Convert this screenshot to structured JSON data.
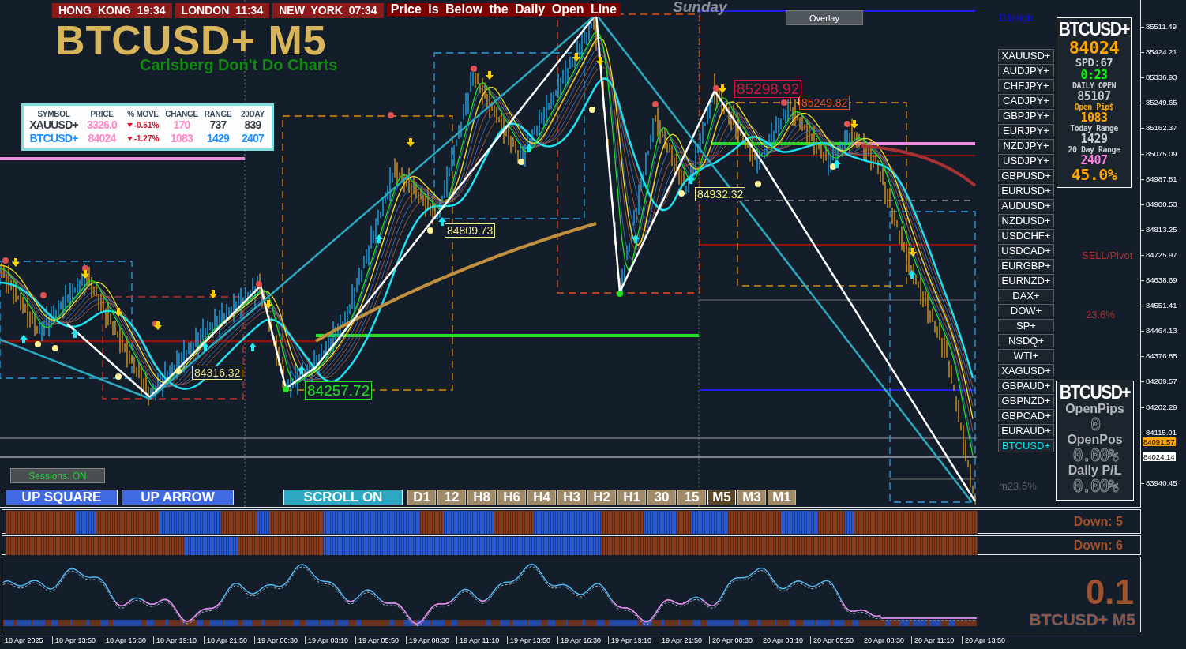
{
  "sessions": [
    {
      "city": "HONG KONG",
      "time": "19:34"
    },
    {
      "city": "LONDON",
      "time": "11:34"
    },
    {
      "city": "NEW YORK",
      "time": "07:34"
    }
  ],
  "alert": "Price is Below the Daily Open Line",
  "day": "Sunday",
  "overlay_button": "Overlay",
  "title": "BTCUSD+ M5",
  "subtitle": "Carlsberg Don't Do Charts",
  "watch_table": {
    "columns": [
      "SYMBOL",
      "PRICE",
      "% MOVE",
      "CHANGE",
      "RANGE",
      "20DAY"
    ],
    "rows": [
      {
        "symbol": "XAUUSD+",
        "price": "3326.0",
        "move": "-0.51%",
        "change": "170",
        "range": "737",
        "day20": "839",
        "color": "#333a44"
      },
      {
        "symbol": "BTCUSD+",
        "price": "84024",
        "move": "-1.27%",
        "change": "1083",
        "range": "1429",
        "day20": "2407",
        "color": "#1e8fff"
      }
    ]
  },
  "level_labels": [
    {
      "text": "D1High",
      "color": "#1010e0"
    },
    {
      "text": "SELL/Pivot",
      "color": "#a83232"
    },
    {
      "text": "23.6%",
      "color": "#a83232"
    },
    {
      "text": "m23.6%",
      "color": "#5a5f66"
    }
  ],
  "price_tags": [
    {
      "text": "85298.92",
      "kind": "large",
      "color": "#dc143c"
    },
    {
      "text": "85249.82",
      "kind": "small",
      "color": "#e8501a"
    },
    {
      "text": "84932.32",
      "kind": "small",
      "color": "#f0e68c"
    },
    {
      "text": "84809.73",
      "kind": "small",
      "color": "#f0e68c"
    },
    {
      "text": "84316.32",
      "kind": "small",
      "color": "#f0e68c"
    },
    {
      "text": "84257.72",
      "kind": "large",
      "color": "#22e022"
    }
  ],
  "symbols": [
    {
      "label": "XAUUSD+",
      "selected": false
    },
    {
      "label": "AUDJPY+",
      "selected": false
    },
    {
      "label": "CHFJPY+",
      "selected": false
    },
    {
      "label": "CADJPY+",
      "selected": false
    },
    {
      "label": "GBPJPY+",
      "selected": false
    },
    {
      "label": "EURJPY+",
      "selected": false
    },
    {
      "label": "NZDJPY+",
      "selected": false
    },
    {
      "label": "USDJPY+",
      "selected": false
    },
    {
      "label": "GBPUSD+",
      "selected": false
    },
    {
      "label": "EURUSD+",
      "selected": false
    },
    {
      "label": "AUDUSD+",
      "selected": false
    },
    {
      "label": "NZDUSD+",
      "selected": false
    },
    {
      "label": "USDCHF+",
      "selected": false
    },
    {
      "label": "USDCAD+",
      "selected": false
    },
    {
      "label": "EURGBP+",
      "selected": false
    },
    {
      "label": "EURNZD+",
      "selected": false
    },
    {
      "label": "DAX+",
      "selected": false
    },
    {
      "label": "DOW+",
      "selected": false
    },
    {
      "label": "SP+",
      "selected": false
    },
    {
      "label": "NSDQ+",
      "selected": false
    },
    {
      "label": "WTI+",
      "selected": false
    },
    {
      "label": "XAGUSD+",
      "selected": false
    },
    {
      "label": "GBPAUD+",
      "selected": false
    },
    {
      "label": "GBPNZD+",
      "selected": false
    },
    {
      "label": "GBPCAD+",
      "selected": false
    },
    {
      "label": "EURAUD+",
      "selected": false
    },
    {
      "label": "BTCUSD+",
      "selected": true
    }
  ],
  "info_panel": {
    "symbol": "BTCUSD+",
    "price": "84024",
    "spread": "SPD:67",
    "timer": "0:23",
    "rows": [
      {
        "label": "DAILY OPEN",
        "value": "85107",
        "color": "#c8ccd2"
      },
      {
        "label": "Open Pip$",
        "value": "1083",
        "color": "#ffa500"
      },
      {
        "label": "Today Range",
        "value": "1429",
        "color": "#c8ccd2"
      },
      {
        "label": "20 Day Range",
        "value": "2407",
        "color": "#ff80e0"
      }
    ],
    "percent": "45.0%"
  },
  "position_panel": {
    "symbol": "BTCUSD+",
    "rows": [
      {
        "label": "OpenPips",
        "value": "0"
      },
      {
        "label": "OpenPos",
        "value": "0.00%"
      },
      {
        "label": "Daily P/L",
        "value": "0.00%"
      }
    ]
  },
  "price_axis": [
    "85511.49",
    "85424.21",
    "85336.93",
    "85249.65",
    "85162.37",
    "85075.09",
    "84987.81",
    "84900.53",
    "84813.25",
    "84725.97",
    "84638.69",
    "84551.41",
    "84464.13",
    "84376.85",
    "84289.57",
    "84202.29",
    "84115.01",
    "83940.45"
  ],
  "current_prices": [
    {
      "text": "84091.57",
      "kind": "bid"
    },
    {
      "text": "84024.14",
      "kind": "last"
    }
  ],
  "sessions_button": "Sessions: ON",
  "mode_buttons": [
    "UP SQUARE",
    "UP ARROW"
  ],
  "scroll_button": "SCROLL ON",
  "timeframes": [
    {
      "label": "D1",
      "selected": false
    },
    {
      "label": "12",
      "selected": false
    },
    {
      "label": "H8",
      "selected": false
    },
    {
      "label": "H6",
      "selected": false
    },
    {
      "label": "H4",
      "selected": false
    },
    {
      "label": "H3",
      "selected": false
    },
    {
      "label": "H2",
      "selected": false
    },
    {
      "label": "H1",
      "selected": false
    },
    {
      "label": "30",
      "selected": false
    },
    {
      "label": "15",
      "selected": false
    },
    {
      "label": "M5",
      "selected": true
    },
    {
      "label": "M3",
      "selected": false
    },
    {
      "label": "M1",
      "selected": false
    }
  ],
  "trend_panels": [
    {
      "label": "Down: 5"
    },
    {
      "label": "Down: 6"
    }
  ],
  "oscillator": {
    "value": "0.1",
    "caption": "BTCUSD+ M5"
  },
  "time_axis": [
    "18 Apr 2025",
    "18 Apr 13:50",
    "18 Apr 16:30",
    "18 Apr 19:10",
    "18 Apr 21:50",
    "19 Apr 00:30",
    "19 Apr 03:10",
    "19 Apr 05:50",
    "19 Apr 08:30",
    "19 Apr 11:10",
    "19 Apr 13:50",
    "19 Apr 16:30",
    "19 Apr 19:10",
    "19 Apr 21:50",
    "20 Apr 00:30",
    "20 Apr 03:10",
    "20 Apr 05:50",
    "20 Apr 08:30",
    "20 Apr 11:10",
    "20 Apr 13:50"
  ]
}
